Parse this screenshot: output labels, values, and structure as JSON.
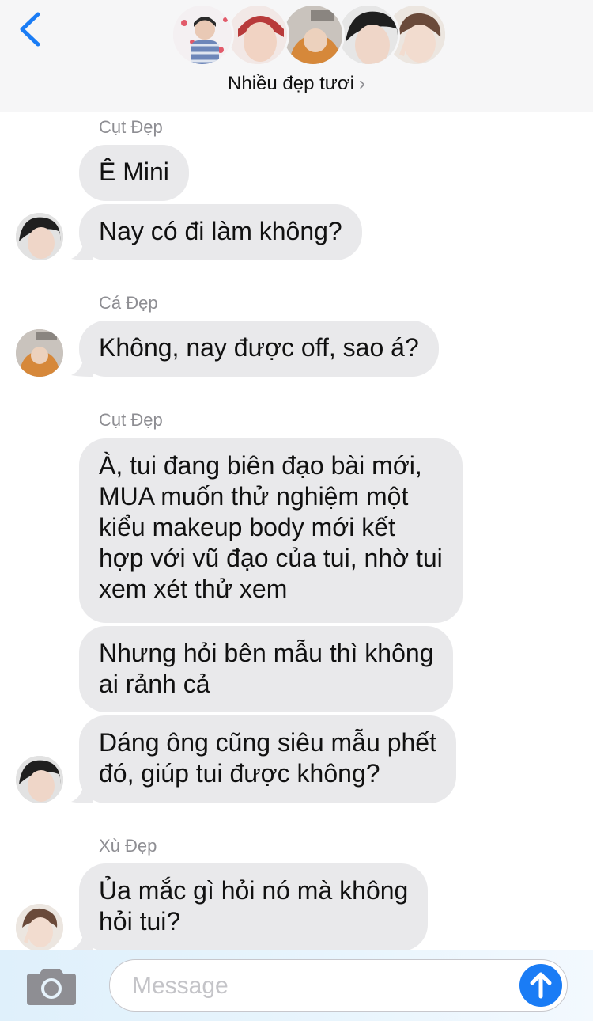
{
  "header": {
    "group_name": "Nhiều đẹp tươi",
    "chevron": "›",
    "accent": "#1a7cf5",
    "avatars": [
      "group-avatar-1",
      "group-avatar-2",
      "group-avatar-3",
      "group-avatar-4",
      "group-avatar-5"
    ]
  },
  "messages": [
    {
      "sender": "Cụt Đẹp",
      "bubbles": [
        [
          "Ê Mini"
        ],
        [
          "Nay có đi làm không?"
        ]
      ]
    },
    {
      "sender": "Cá Đẹp",
      "bubbles": [
        [
          "Không, nay được off, sao á?"
        ]
      ]
    },
    {
      "sender": "Cụt Đẹp",
      "bubbles": [
        [
          "À, tui đang biên đạo bài mới,",
          "MUA muốn thử nghiệm một",
          "kiểu makeup body mới kết",
          "hợp với vũ đạo của tui, nhờ tui",
          "xem xét thử xem"
        ],
        [
          "Nhưng hỏi bên mẫu thì không",
          "ai rảnh cả"
        ],
        [
          "Dáng ông cũng siêu mẫu phết",
          "đó, giúp tui được không?"
        ]
      ]
    },
    {
      "sender": "Xù Đẹp",
      "bubbles": [
        [
          "Ủa mắc gì hỏi nó mà không",
          "hỏi tui?"
        ]
      ]
    }
  ],
  "composer": {
    "placeholder": "Message",
    "camera_icon": "camera-icon",
    "send_icon": "arrow-up-icon"
  }
}
